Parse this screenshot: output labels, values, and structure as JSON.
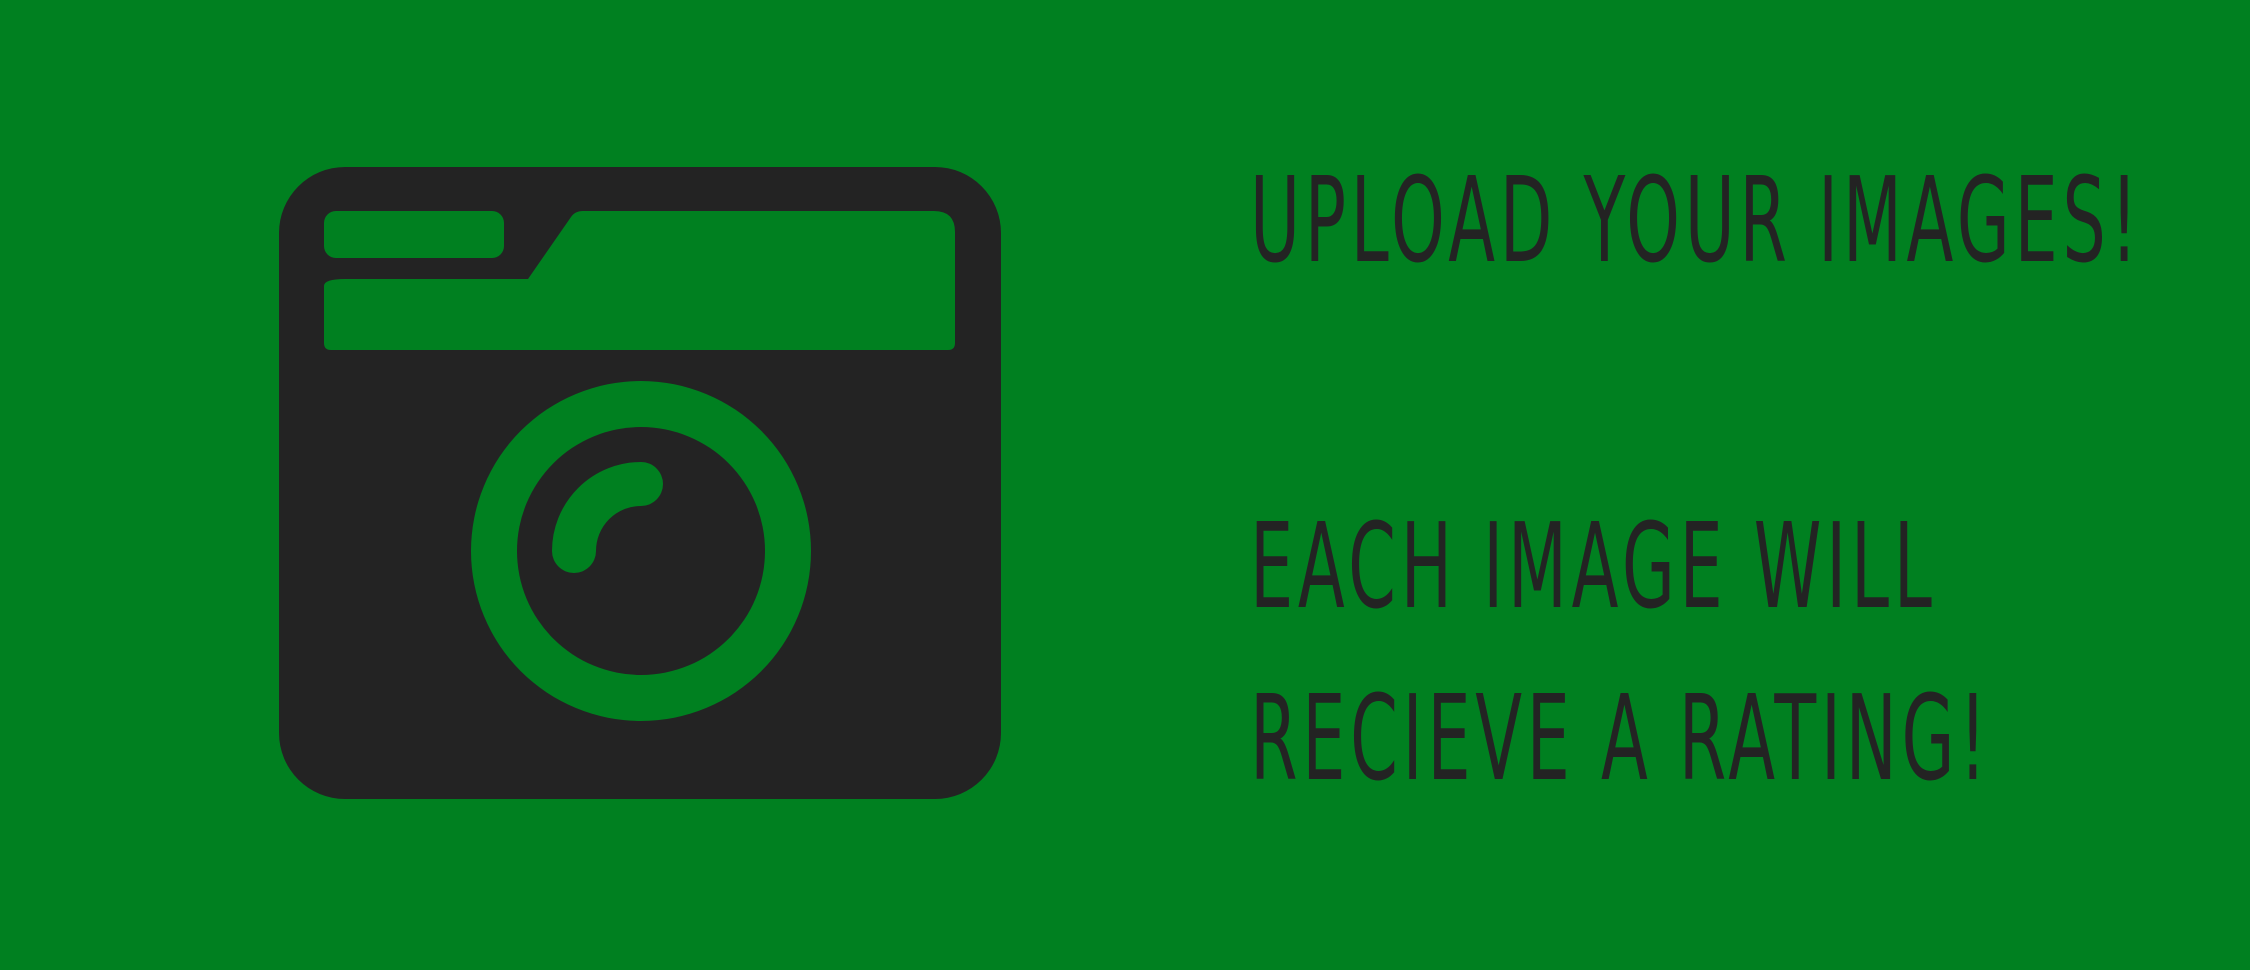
{
  "banner": {
    "background_color": "#008020",
    "ink_color": "#232323",
    "icon": "camera-icon",
    "headline": "UPLOAD YOUR IMAGES!",
    "subtext_line1": "EACH IMAGE WILL",
    "subtext_line2": "RECIEVE A RATING!"
  }
}
